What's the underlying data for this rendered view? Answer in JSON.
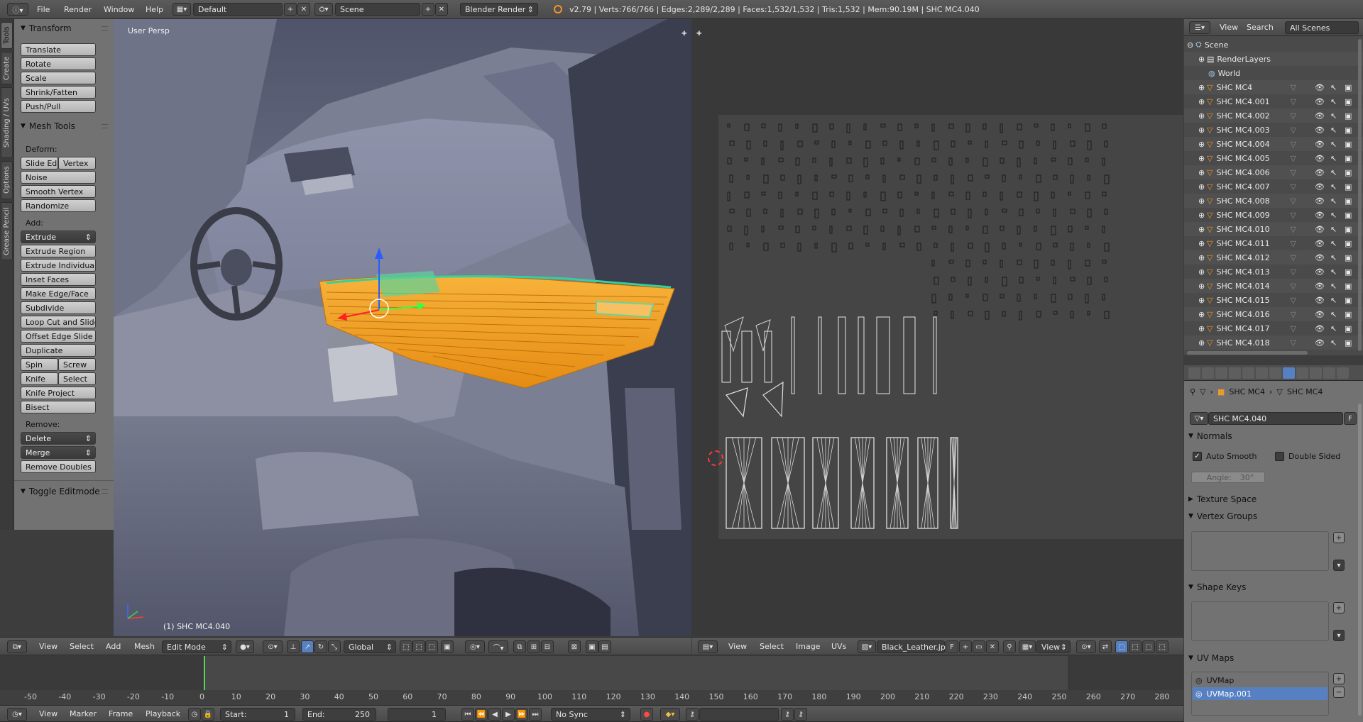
{
  "topbar": {
    "menus": [
      "File",
      "Render",
      "Window",
      "Help"
    ],
    "layout": "Default",
    "scene": "Scene",
    "engine": "Blender Render",
    "stats": "v2.79 | Verts:766/766 | Edges:2,289/2,289 | Faces:1,532/1,532 | Tris:1,532 | Mem:90.19M | SHC MC4.040"
  },
  "tool_tabs": [
    "Tools",
    "Create",
    "Shading / UVs",
    "Options",
    "Grease Pencil"
  ],
  "toolshelf": {
    "transform": {
      "title": "Transform",
      "buttons": [
        "Translate",
        "Rotate",
        "Scale",
        "Shrink/Fatten",
        "Push/Pull"
      ]
    },
    "mesh_tools": {
      "title": "Mesh Tools",
      "deform_label": "Deform:",
      "slide_edge": "Slide Ed",
      "vertex": "Vertex",
      "deform": [
        "Noise",
        "Smooth Vertex",
        "Randomize"
      ],
      "add_label": "Add:",
      "extrude": "Extrude",
      "add": [
        "Extrude Region",
        "Extrude Individual",
        "Inset Faces",
        "Make Edge/Face",
        "Subdivide",
        "Loop Cut and Slide",
        "Offset Edge Slide",
        "Duplicate"
      ],
      "spin": "Spin",
      "screw": "Screw",
      "knife": "Knife",
      "select": "Select",
      "knife_project": "Knife Project",
      "bisect": "Bisect",
      "remove_label": "Remove:",
      "delete": "Delete",
      "merge": "Merge",
      "remove_doubles": "Remove Doubles"
    },
    "toggle": "Toggle Editmode"
  },
  "viewport": {
    "view_name": "User Persp",
    "object_label": "(1) SHC MC4.040"
  },
  "view3d_header": {
    "menus": [
      "View",
      "Select",
      "Add",
      "Mesh"
    ],
    "mode": "Edit Mode",
    "orientation": "Global"
  },
  "uv_header": {
    "menus": [
      "View",
      "Select",
      "Image",
      "UVs"
    ],
    "image": "Black_Leather.jpg",
    "fake_user": "F",
    "view": "View"
  },
  "outliner": {
    "menus": [
      "View",
      "Search"
    ],
    "filter": "All Scenes",
    "scene": "Scene",
    "renderlayers": "RenderLayers",
    "world": "World",
    "objects": [
      "SHC MC4",
      "SHC MC4.001",
      "SHC MC4.002",
      "SHC MC4.003",
      "SHC MC4.004",
      "SHC MC4.005",
      "SHC MC4.006",
      "SHC MC4.007",
      "SHC MC4.008",
      "SHC MC4.009",
      "SHC MC4.010",
      "SHC MC4.011",
      "SHC MC4.012",
      "SHC MC4.013",
      "SHC MC4.014",
      "SHC MC4.015",
      "SHC MC4.016",
      "SHC MC4.017",
      "SHC MC4.018"
    ]
  },
  "properties": {
    "breadcrumb_object": "SHC MC4",
    "breadcrumb_mesh": "SHC MC4",
    "mesh_name": "SHC MC4.040",
    "fake_user": "F",
    "normals": "Normals",
    "auto_smooth": "Auto Smooth",
    "double_sided": "Double Sided",
    "angle": "Angle:",
    "angle_value": "30°",
    "texture_space": "Texture Space",
    "vertex_groups": "Vertex Groups",
    "shape_keys": "Shape Keys",
    "uv_maps": "UV Maps",
    "uvmaps": [
      "UVMap",
      "UVMap.001"
    ]
  },
  "timeline": {
    "ticks": [
      "-50",
      "-40",
      "-30",
      "-20",
      "-10",
      "0",
      "10",
      "20",
      "30",
      "40",
      "50",
      "60",
      "70",
      "80",
      "90",
      "100",
      "110",
      "120",
      "130",
      "140",
      "150",
      "160",
      "170",
      "180",
      "190",
      "200",
      "210",
      "220",
      "230",
      "240",
      "250",
      "260",
      "270",
      "280"
    ],
    "menus": [
      "View",
      "Marker",
      "Frame",
      "Playback"
    ],
    "start": "Start:",
    "start_value": "1",
    "end": "End:",
    "end_value": "250",
    "current": "1",
    "sync": "No Sync"
  },
  "colors": {
    "selection": "#f29a1f",
    "viewport_bg": "#7d8193",
    "uv_bg": "#393939",
    "active_highlight": "#5680c2"
  }
}
